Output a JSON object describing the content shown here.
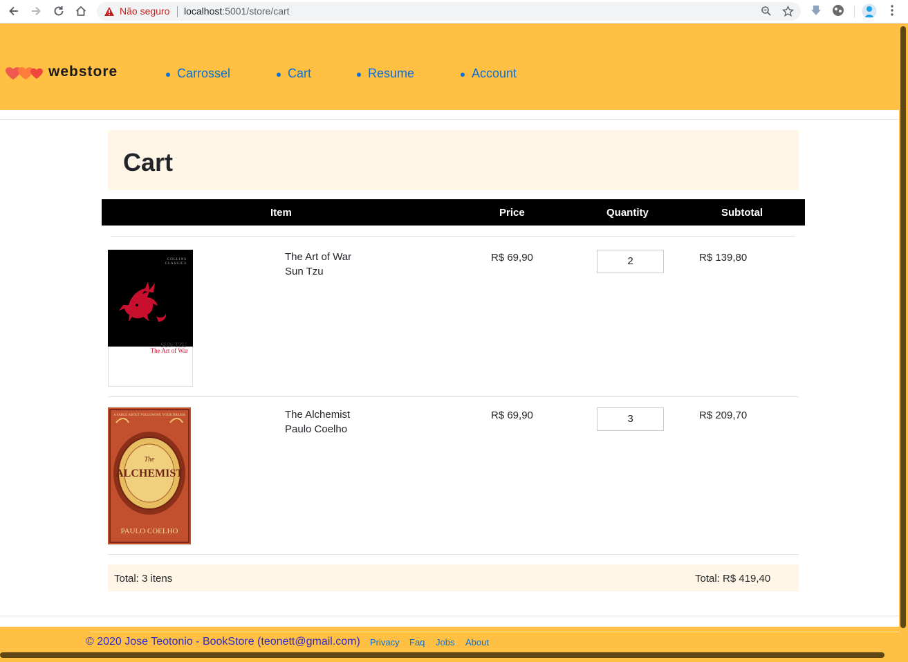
{
  "browser": {
    "insecure_label": "Não seguro",
    "url_host": "localhost",
    "url_path": ":5001/store/cart"
  },
  "header": {
    "logo_text": "webstore",
    "nav": [
      {
        "label": "Carrossel"
      },
      {
        "label": "Cart"
      },
      {
        "label": "Resume"
      },
      {
        "label": "Account"
      }
    ]
  },
  "page": {
    "title": "Cart"
  },
  "table": {
    "columns": [
      "Item",
      "Price",
      "Quantity",
      "Subtotal"
    ],
    "rows": [
      {
        "title": "The Art of War",
        "author": "Sun Tzu",
        "price": "R$ 69,90",
        "quantity": "2",
        "subtotal": "R$ 139,80",
        "cover": {
          "publisher_line1": "COLLINS",
          "publisher_line2": "CLASSICS",
          "author": "SUN TZU",
          "title": "The Art of War"
        }
      },
      {
        "title": "The Alchemist",
        "author": "Paulo Coelho",
        "price": "R$ 69,90",
        "quantity": "3",
        "subtotal": "R$ 209,70",
        "cover": {
          "tagline": "A FABLE ABOUT FOLLOWING YOUR DREAM",
          "the": "The",
          "title": "ALCHEMIST",
          "author": "PAULO COELHO"
        }
      }
    ]
  },
  "totals": {
    "items_label": "Total: 3 itens",
    "price_label": "Total: R$ 419,40"
  },
  "footer": {
    "copyright": "© 2020 Jose Teotonio - BookStore (teonett@gmail.com)",
    "links": [
      "Privacy",
      "Faq",
      "Jobs",
      "About"
    ]
  },
  "colors": {
    "header_bg": "#ffc044",
    "link_blue": "#0a6fd6",
    "soft_bg": "#fff6e8",
    "table_head_bg": "#000000"
  }
}
